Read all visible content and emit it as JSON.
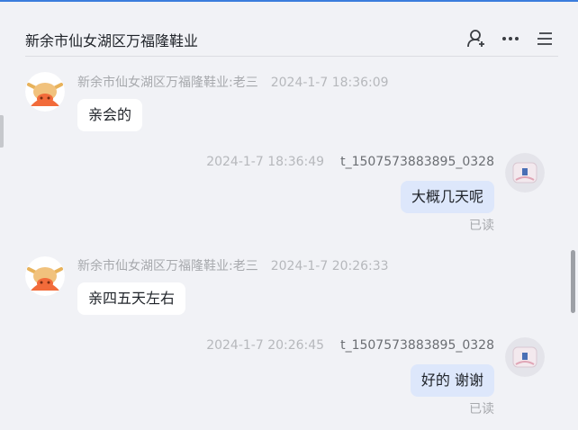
{
  "header": {
    "title": "新余市仙女湖区万福隆鞋业",
    "icons": [
      "user-add-icon",
      "more-icon",
      "menu-icon"
    ]
  },
  "messages": [
    {
      "direction": "in",
      "sender": "新余市仙女湖区万福隆鞋业:老三",
      "time": "2024-1-7 18:36:09",
      "text": "亲会的"
    },
    {
      "direction": "out",
      "sender": "t_1507573883895_0328",
      "time": "2024-1-7 18:36:49",
      "text": "大概几天呢",
      "status": "已读"
    },
    {
      "direction": "in",
      "sender": "新余市仙女湖区万福隆鞋业:老三",
      "time": "2024-1-7 20:26:33",
      "text": "亲四五天左右"
    },
    {
      "direction": "out",
      "sender": "t_1507573883895_0328",
      "time": "2024-1-7 20:26:45",
      "text": "好的 谢谢",
      "status": "已读"
    }
  ],
  "colors": {
    "accent": "#3b7ddd",
    "outgoing_bubble": "#dde7fb",
    "incoming_bubble": "#ffffff",
    "background": "#f1f2f6"
  }
}
